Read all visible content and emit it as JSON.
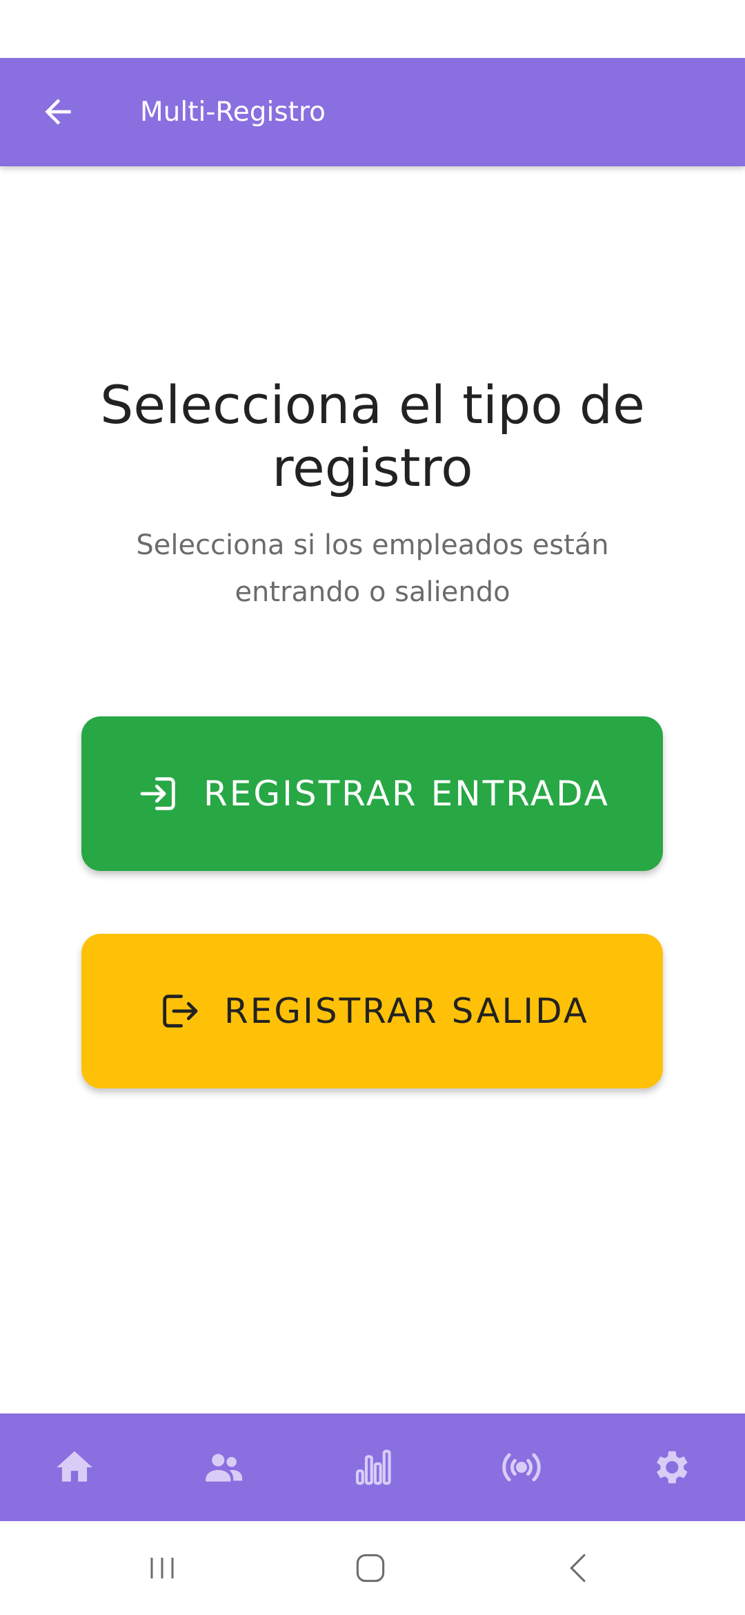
{
  "app_bar": {
    "title": "Multi-Registro",
    "back_icon": "arrow-left-icon"
  },
  "main": {
    "heading": "Selecciona el tipo de registro",
    "subheading": "Selecciona si los empleados están entrando o saliendo",
    "entrada_button": {
      "label": "REGISTRAR ENTRADA",
      "icon": "login-icon",
      "color": "#28a745"
    },
    "salida_button": {
      "label": "REGISTRAR SALIDA",
      "icon": "logout-icon",
      "color": "#ffc107"
    }
  },
  "bottom_nav": {
    "background": "#8a6fe0",
    "icon_color": "#d9cdf7",
    "items": [
      {
        "icon": "home-icon"
      },
      {
        "icon": "users-icon"
      },
      {
        "icon": "bar-chart-icon"
      },
      {
        "icon": "broadcast-icon"
      },
      {
        "icon": "gear-icon"
      }
    ]
  },
  "system_nav": {
    "items": [
      {
        "icon": "recent-apps-icon"
      },
      {
        "icon": "home-square-icon"
      },
      {
        "icon": "back-chevron-icon"
      }
    ]
  }
}
